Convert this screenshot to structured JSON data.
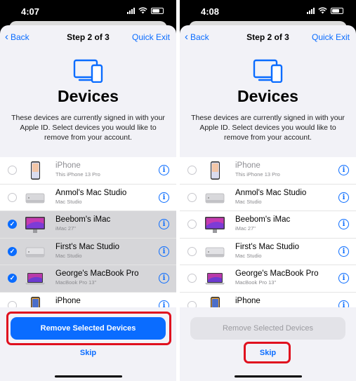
{
  "accent_color": "#0a6cff",
  "highlight_color": "#e0101e",
  "screens": [
    {
      "time": "4:07",
      "nav": {
        "back": "Back",
        "step": "Step 2 of 3",
        "quick_exit": "Quick Exit"
      },
      "title": "Devices",
      "description": "These devices are currently signed in with your Apple ID. Select devices you would like to remove from your account.",
      "devices": [
        {
          "name": "iPhone",
          "subtitle": "This iPhone 13 Pro",
          "selected": false,
          "icon": "iphone-icon"
        },
        {
          "name": "Anmol's Mac Studio",
          "subtitle": "Mac Studio",
          "selected": false,
          "icon": "mac-studio-icon"
        },
        {
          "name": "Beebom's iMac",
          "subtitle": "iMac 27\"",
          "selected": true,
          "icon": "imac-icon"
        },
        {
          "name": "First's Mac Studio",
          "subtitle": "Mac Studio",
          "selected": true,
          "icon": "mac-studio-icon"
        },
        {
          "name": "George's MacBook Pro",
          "subtitle": "MacBook Pro 13\"",
          "selected": true,
          "icon": "macbook-icon"
        },
        {
          "name": "iPhone",
          "subtitle": "",
          "selected": false,
          "icon": "iphone-icon"
        }
      ],
      "primary_button": "Remove Selected Devices",
      "skip": "Skip"
    },
    {
      "time": "4:08",
      "nav": {
        "back": "Back",
        "step": "Step 2 of 3",
        "quick_exit": "Quick Exit"
      },
      "title": "Devices",
      "description": "These devices are currently signed in with your Apple ID. Select devices you would like to remove from your account.",
      "devices": [
        {
          "name": "iPhone",
          "subtitle": "This iPhone 13 Pro",
          "selected": false,
          "icon": "iphone-icon"
        },
        {
          "name": "Anmol's Mac Studio",
          "subtitle": "Mac Studio",
          "selected": false,
          "icon": "mac-studio-icon"
        },
        {
          "name": "Beebom's iMac",
          "subtitle": "iMac 27\"",
          "selected": false,
          "icon": "imac-icon"
        },
        {
          "name": "First's Mac Studio",
          "subtitle": "Mac Studio",
          "selected": false,
          "icon": "mac-studio-icon"
        },
        {
          "name": "George's MacBook Pro",
          "subtitle": "MacBook Pro 13\"",
          "selected": false,
          "icon": "macbook-icon"
        },
        {
          "name": "iPhone",
          "subtitle": "",
          "selected": false,
          "icon": "iphone-icon"
        }
      ],
      "primary_button": "Remove Selected Devices",
      "skip": "Skip"
    }
  ]
}
